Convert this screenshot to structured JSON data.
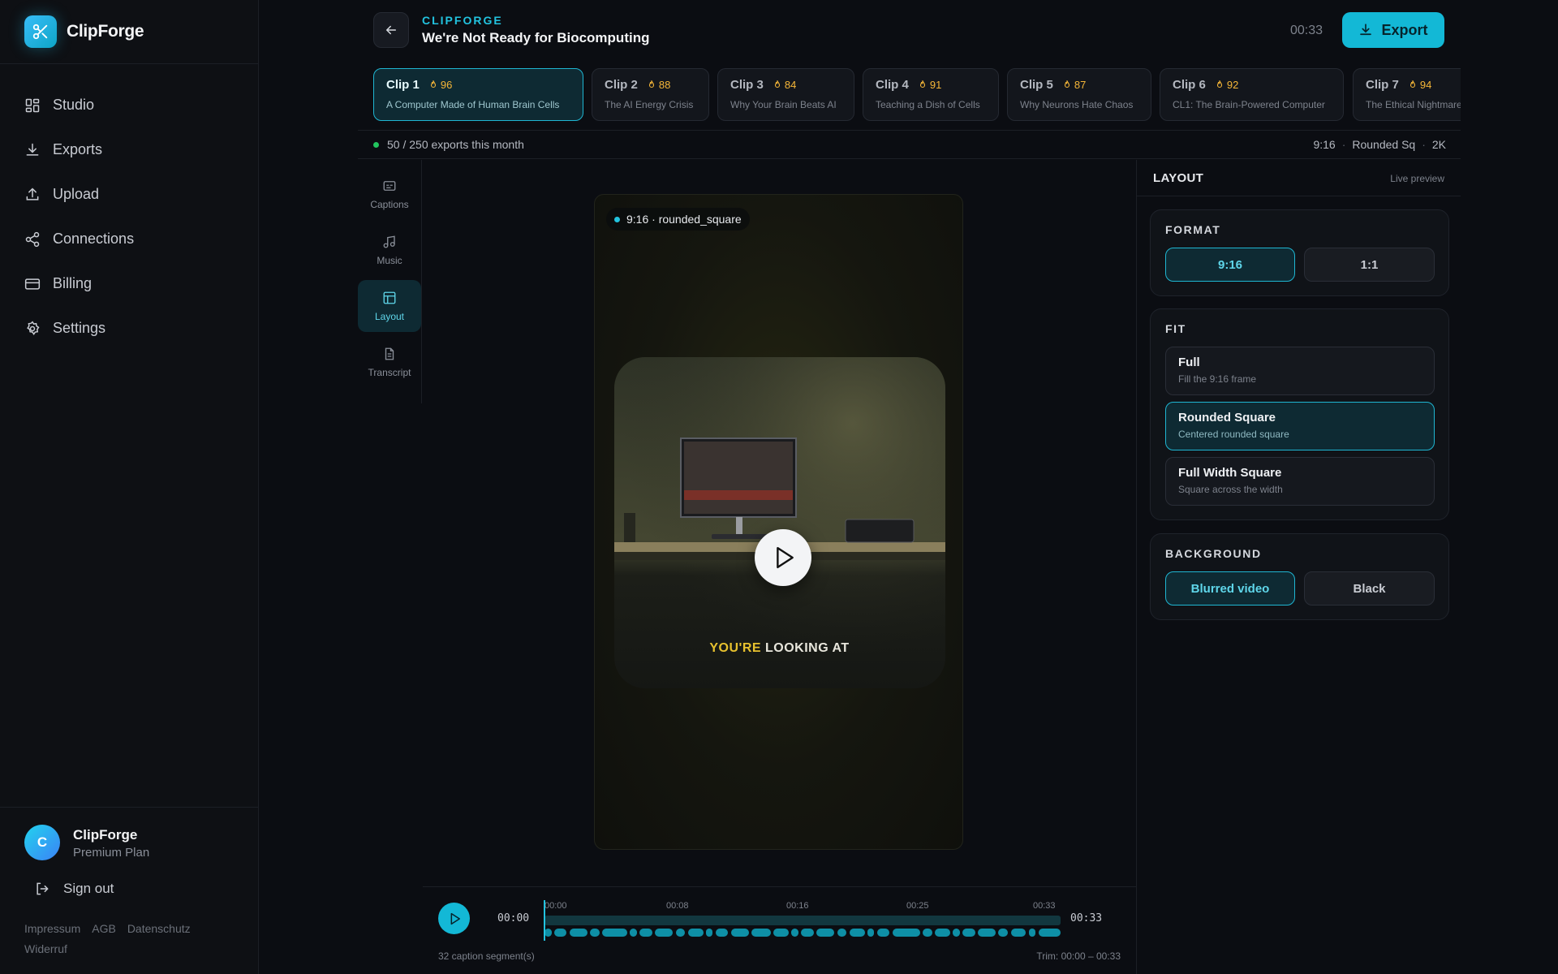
{
  "app": {
    "name": "ClipForge"
  },
  "sidebar": {
    "items": [
      {
        "label": "Studio",
        "icon": "grid-icon"
      },
      {
        "label": "Exports",
        "icon": "download-icon"
      },
      {
        "label": "Upload",
        "icon": "upload-icon"
      },
      {
        "label": "Connections",
        "icon": "share-icon"
      },
      {
        "label": "Billing",
        "icon": "credit-card-icon"
      },
      {
        "label": "Settings",
        "icon": "gear-icon"
      }
    ],
    "profile": {
      "initial": "C",
      "name": "ClipForge",
      "plan": "Premium Plan"
    },
    "signout_label": "Sign out",
    "legal": [
      "Impressum",
      "AGB",
      "Datenschutz",
      "Widerruf"
    ]
  },
  "header": {
    "eyebrow": "CLIPFORGE",
    "title": "We're Not Ready for Biocomputing",
    "duration": "00:33",
    "export_label": "Export"
  },
  "clips": [
    {
      "name": "Clip 1",
      "score": "96",
      "subtitle": "A Computer Made of Human Brain Cells",
      "active": true
    },
    {
      "name": "Clip 2",
      "score": "88",
      "subtitle": "The AI Energy Crisis"
    },
    {
      "name": "Clip 3",
      "score": "84",
      "subtitle": "Why Your Brain Beats AI"
    },
    {
      "name": "Clip 4",
      "score": "91",
      "subtitle": "Teaching a Dish of Cells"
    },
    {
      "name": "Clip 5",
      "score": "87",
      "subtitle": "Why Neurons Hate Chaos"
    },
    {
      "name": "Clip 6",
      "score": "92",
      "subtitle": "CL1: The Brain-Powered Computer"
    },
    {
      "name": "Clip 7",
      "score": "94",
      "subtitle": "The Ethical Nightmare"
    }
  ],
  "infobar": {
    "exports_text": "50 / 250 exports this month",
    "aspect": "9:16",
    "layout": "Rounded Sq",
    "resolution": "2K"
  },
  "tools": [
    {
      "label": "Captions",
      "icon": "captions-icon"
    },
    {
      "label": "Music",
      "icon": "music-note-icon"
    },
    {
      "label": "Layout",
      "icon": "layout-icon",
      "active": true
    },
    {
      "label": "Transcript",
      "icon": "document-icon"
    }
  ],
  "preview": {
    "badge": "9:16 · rounded_square",
    "caption_highlight": "YOU'RE",
    "caption_rest": "LOOKING AT"
  },
  "timeline": {
    "current": "00:00",
    "total": "00:33",
    "ticks": [
      "00:00",
      "00:08",
      "00:16",
      "00:25",
      "00:33"
    ],
    "segments_label": "32 caption segment(s)",
    "trim_label": "Trim: 00:00 – 00:33"
  },
  "panel": {
    "title": "LAYOUT",
    "live_label": "Live preview",
    "format": {
      "label": "FORMAT",
      "options": [
        "9:16",
        "1:1"
      ],
      "selected": "9:16"
    },
    "fit": {
      "label": "FIT",
      "options": [
        {
          "title": "Full",
          "subtitle": "Fill the 9:16 frame"
        },
        {
          "title": "Rounded Square",
          "subtitle": "Centered rounded square",
          "selected": true
        },
        {
          "title": "Full Width Square",
          "subtitle": "Square across the width"
        }
      ]
    },
    "background": {
      "label": "BACKGROUND",
      "options": [
        "Blurred video",
        "Black"
      ],
      "selected": "Blurred video"
    }
  },
  "colors": {
    "accent": "#13b8d6",
    "score": "#f5b638",
    "status_dot": "#22c55e",
    "caption_highlight": "#e7c12e"
  }
}
